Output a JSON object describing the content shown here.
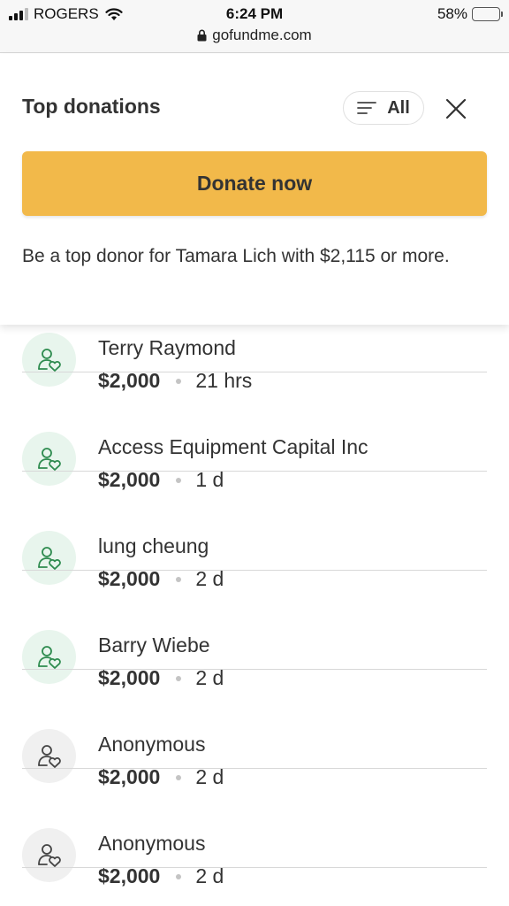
{
  "status_bar": {
    "carrier": "ROGERS",
    "time": "6:24 PM",
    "battery_percent": "58%",
    "battery_level": 0.58,
    "url": "gofundme.com"
  },
  "header": {
    "title": "Top donations",
    "filter_label": "All",
    "donate_label": "Donate now",
    "top_donor_text": "Be a top donor for Tamara Lich with $2,115 or more."
  },
  "colors": {
    "donate_button": "#f2b94a",
    "avatar_green_bg": "#e8f5ed",
    "avatar_green_icon": "#2e8b4f",
    "avatar_gray_bg": "#f0f0f0"
  },
  "donations": [
    {
      "name": "Terry Raymond",
      "amount": "$2,000",
      "time": "21 hrs",
      "avatar": "green"
    },
    {
      "name": "Access Equipment Capital Inc",
      "amount": "$2,000",
      "time": "1 d",
      "avatar": "green"
    },
    {
      "name": "lung cheung",
      "amount": "$2,000",
      "time": "2 d",
      "avatar": "green"
    },
    {
      "name": "Barry Wiebe",
      "amount": "$2,000",
      "time": "2 d",
      "avatar": "green"
    },
    {
      "name": "Anonymous",
      "amount": "$2,000",
      "time": "2 d",
      "avatar": "gray"
    },
    {
      "name": "Anonymous",
      "amount": "$2,000",
      "time": "2 d",
      "avatar": "gray"
    }
  ]
}
